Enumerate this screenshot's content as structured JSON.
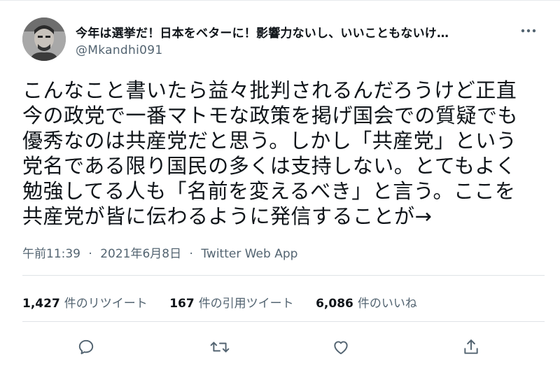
{
  "tweet": {
    "display_name": "今年は選挙だ！日本をベターに！影響力ないし、いいこともないけ…",
    "handle": "@Mkandhi091",
    "text": "こんなこと書いたら益々批判されるんだろうけど正直\n今の政党で一番マトモな政策を掲げ国会での質疑でも\n優秀なのは共産党だと思う。しかし「共産党」という\n党名である限り国民の多くは支持しない。とてもよく\n勉強してる人も「名前を変えるべき」と言う。ここを\n共産党が皆に伝わるように発信することが→",
    "time": "午前11:39",
    "date": "2021年6月8日",
    "separator": "·",
    "source": "Twitter Web App"
  },
  "stats": {
    "retweets": {
      "count": "1,427",
      "label": "件のリツイート"
    },
    "quotes": {
      "count": "167",
      "label": "件の引用ツイート"
    },
    "likes": {
      "count": "6,086",
      "label": "件のいいね"
    }
  },
  "icons": {
    "more": "more-dots-icon",
    "reply": "reply-icon",
    "retweet": "retweet-icon",
    "like": "heart-icon",
    "share": "share-icon"
  },
  "colors": {
    "text": "#0f1419",
    "secondary": "#536471",
    "divider": "#dfe3e6"
  }
}
